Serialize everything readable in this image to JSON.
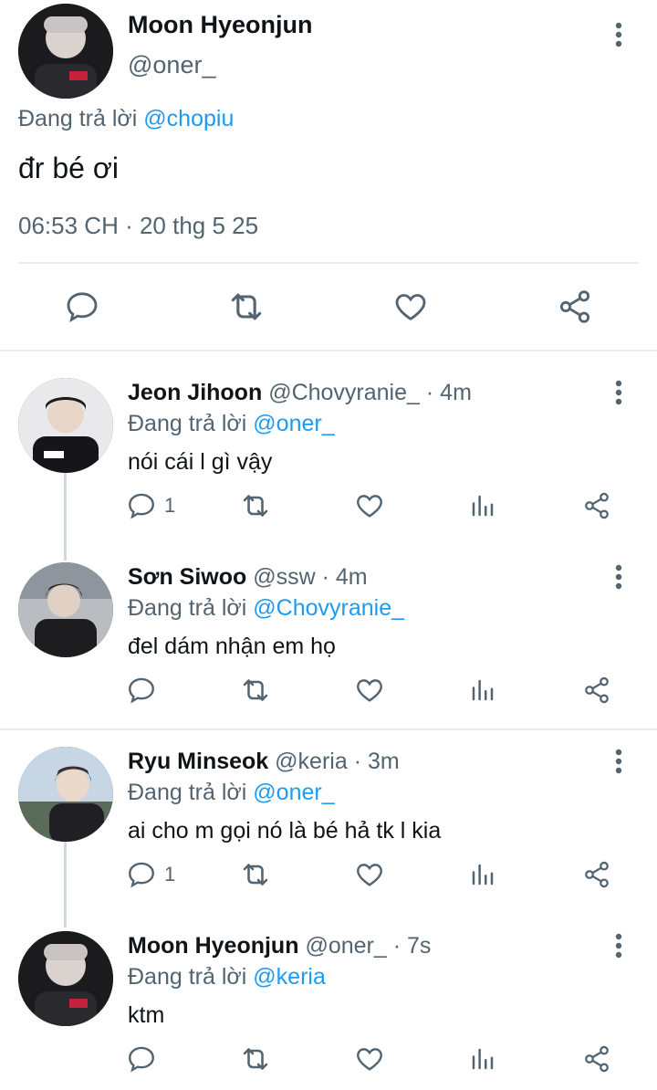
{
  "main_tweet": {
    "name": "Moon Hyeonjun",
    "handle": "@oner_",
    "reply_prefix": "Đang trả lời",
    "reply_to": "@chopiu",
    "text": "đr bé ơi",
    "timestamp": "06:53 CH · 20 thg 5 25"
  },
  "replies": [
    {
      "name": "Jeon Jihoon",
      "handle": "@Chovyranie_",
      "time": "· 4m",
      "reply_prefix": "Đang trả lời",
      "reply_to": "@oner_",
      "text": "nói cái l gì vậy",
      "reply_count": "1"
    },
    {
      "name": "Sơn Siwoo",
      "handle": "@ssw",
      "time": "· 4m",
      "reply_prefix": "Đang trả lời",
      "reply_to": "@Chovyranie_",
      "text": "đel dám nhận em họ",
      "reply_count": ""
    },
    {
      "name": "Ryu Minseok",
      "handle": "@keria",
      "time": "· 3m",
      "reply_prefix": "Đang trả lời",
      "reply_to": "@oner_",
      "text": "ai cho m gọi nó là bé hả tk l kia",
      "reply_count": "1"
    },
    {
      "name": "Moon Hyeonjun",
      "handle": "@oner_",
      "time": "· 7s",
      "reply_prefix": "Đang trả lời",
      "reply_to": "@keria",
      "text": "ktm",
      "reply_count": ""
    }
  ],
  "icons": {
    "more": "more-vertical-icon",
    "reply": "reply-icon",
    "retweet": "retweet-icon",
    "like": "heart-icon",
    "views": "views-icon",
    "share": "share-icon"
  },
  "colors": {
    "link": "#1d9bf0",
    "muted": "#536471",
    "divider": "#e6ecf0"
  }
}
